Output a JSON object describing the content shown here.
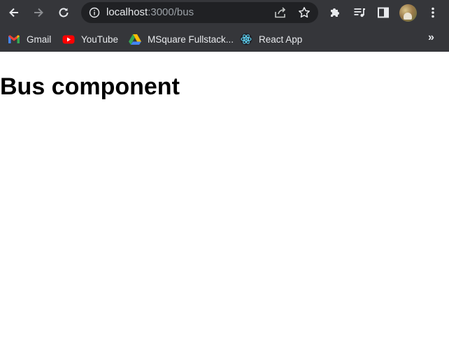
{
  "browser": {
    "url_host": "localhost",
    "url_rest": ":3000/bus",
    "bookmarks": [
      {
        "label": "Gmail",
        "icon": "gmail-icon"
      },
      {
        "label": "YouTube",
        "icon": "youtube-icon"
      },
      {
        "label": "MSquare Fullstack...",
        "icon": "google-drive-icon"
      },
      {
        "label": "React App",
        "icon": "react-icon"
      }
    ],
    "overflow_label": "»"
  },
  "page": {
    "heading": "Bus component"
  },
  "colors": {
    "chrome_bg": "#35363a",
    "omnibox_bg": "#202124",
    "text_light": "#e8eaed",
    "text_dim": "#9aa0a6"
  }
}
